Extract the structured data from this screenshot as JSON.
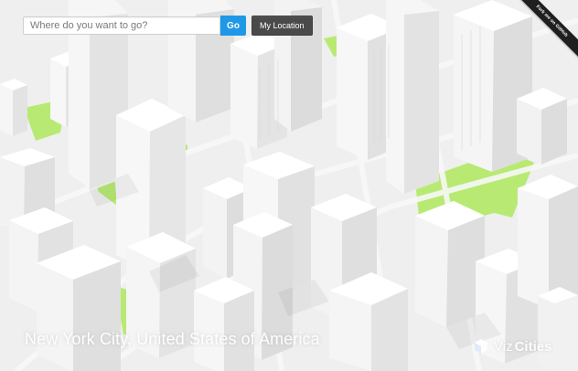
{
  "search": {
    "placeholder": "Where do you want to go?",
    "go_label": "Go",
    "location_label": "My Location"
  },
  "corner_ribbon": {
    "label": "Fork me on GitHub"
  },
  "map": {
    "city_label": "New York City, United States of America",
    "brand_prefix": "Viz",
    "brand_suffix": "Cities"
  },
  "colors": {
    "accent": "#1f98e6",
    "dark_button": "#4a4a4a",
    "park": "#b8ea73",
    "building_light": "#f6f6f6",
    "building_mid": "#e6e6e6",
    "building_dark": "#cfcfcf",
    "ribbon": "#1f1f1f"
  },
  "icons": {
    "brand_logo": "isometric-cube-icon"
  }
}
